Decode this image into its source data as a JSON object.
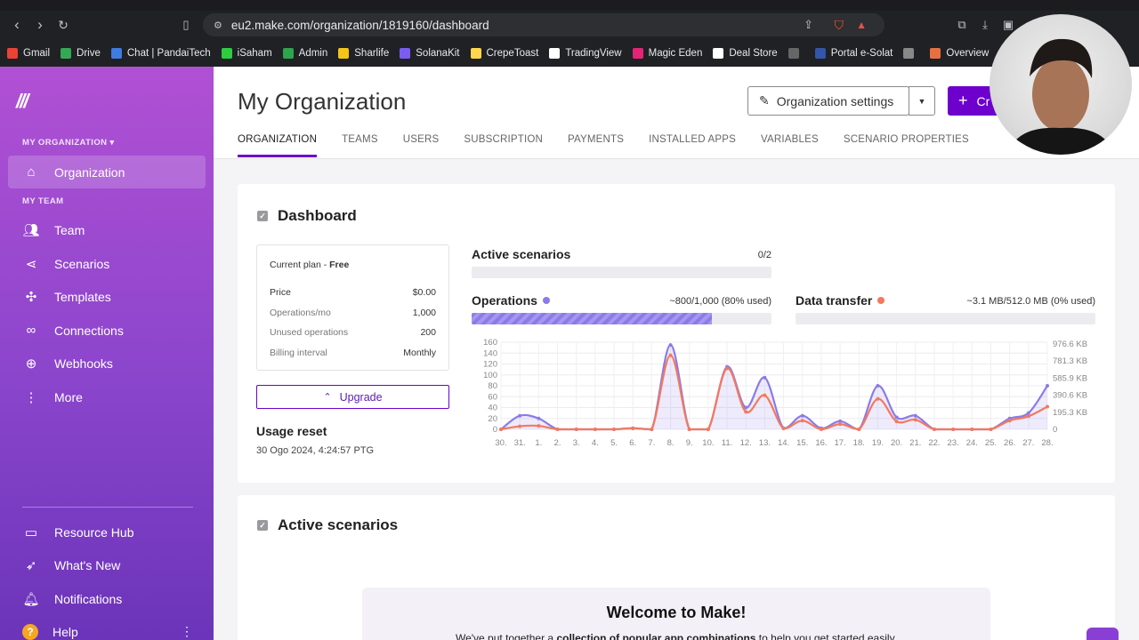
{
  "browser": {
    "url": "eu2.make.com/organization/1819160/dashboard",
    "bookmarks": [
      {
        "label": "Gmail",
        "color": "#ea4335"
      },
      {
        "label": "Drive",
        "color": "#34a853"
      },
      {
        "label": "Chat | PandaiTech",
        "color": "#3f7be0"
      },
      {
        "label": "iSaham",
        "color": "#2ecc40"
      },
      {
        "label": "Admin",
        "color": "#2ea44f"
      },
      {
        "label": "Sharlife",
        "color": "#f5c518"
      },
      {
        "label": "SolanaKit",
        "color": "#7b5cf0"
      },
      {
        "label": "CrepeToast",
        "color": "#ffd84d"
      },
      {
        "label": "TradingView",
        "color": "#ffffff"
      },
      {
        "label": "Magic Eden",
        "color": "#e42575"
      },
      {
        "label": "Deal Store",
        "color": "#ffffff"
      },
      {
        "label": "",
        "color": "#666666"
      },
      {
        "label": "Portal e-Solat",
        "color": "#3355aa"
      },
      {
        "label": "",
        "color": "#888888"
      },
      {
        "label": "Overview",
        "color": "#e87040"
      }
    ]
  },
  "sidebar": {
    "org_label": "MY ORGANIZATION ▾",
    "org_item": "Organization",
    "team_label": "MY TEAM",
    "items": [
      "Team",
      "Scenarios",
      "Templates",
      "Connections",
      "Webhooks",
      "More"
    ],
    "bottom_items": [
      "Resource Hub",
      "What's New",
      "Notifications",
      "Help"
    ]
  },
  "header": {
    "title": "My Organization",
    "settings_label": "Organization settings",
    "create_label": "Cr",
    "tabs": [
      "ORGANIZATION",
      "TEAMS",
      "USERS",
      "SUBSCRIPTION",
      "PAYMENTS",
      "INSTALLED APPS",
      "VARIABLES",
      "SCENARIO PROPERTIES"
    ]
  },
  "dashboard": {
    "title": "Dashboard",
    "plan": {
      "current_plan_label": "Current plan - ",
      "current_plan_value": "Free",
      "rows": [
        {
          "k": "Price",
          "v": "$0.00"
        },
        {
          "k": "Operations/mo",
          "v": "1,000"
        },
        {
          "k": "Unused operations",
          "v": "200"
        },
        {
          "k": "Billing interval",
          "v": "Monthly"
        }
      ]
    },
    "upgrade_label": "Upgrade",
    "usage_reset_title": "Usage reset",
    "usage_reset_value": "30 Ogo 2024, 4:24:57 PTG",
    "active_scenarios": {
      "label": "Active scenarios",
      "value": "0/2",
      "fraction": 0.0
    },
    "operations": {
      "label": "Operations",
      "value": "~800/1,000 (80% used)",
      "fraction": 0.8,
      "color": "#8b7be8"
    },
    "data_transfer": {
      "label": "Data transfer",
      "value": "~3.1 MB/512.0 MB (0% used)",
      "fraction": 0.0,
      "color": "#f27a5e"
    }
  },
  "chart_data": {
    "type": "line",
    "categories": [
      "30.",
      "31.",
      "1.",
      "2.",
      "3.",
      "4.",
      "5.",
      "6.",
      "7.",
      "8.",
      "9.",
      "10.",
      "11.",
      "12.",
      "13.",
      "14.",
      "15.",
      "16.",
      "17.",
      "18.",
      "19.",
      "20.",
      "21.",
      "22.",
      "23.",
      "24.",
      "25.",
      "26.",
      "27.",
      "28."
    ],
    "y_left_ticks": [
      "0",
      "20",
      "40",
      "60",
      "80",
      "100",
      "120",
      "140",
      "160"
    ],
    "y_left_range": [
      0,
      160
    ],
    "y_right_ticks": [
      "0",
      "195.3 KB",
      "390.6 KB",
      "585.9 KB",
      "781.3 KB",
      "976.6 KB"
    ],
    "series": [
      {
        "name": "Operations",
        "axis": "left",
        "color": "#8b7be8",
        "values": [
          0,
          25,
          20,
          0,
          0,
          0,
          0,
          2,
          0,
          155,
          0,
          0,
          115,
          40,
          95,
          2,
          25,
          2,
          15,
          0,
          80,
          22,
          25,
          0,
          0,
          0,
          0,
          20,
          30,
          80
        ]
      },
      {
        "name": "Data transfer",
        "axis": "right",
        "color": "#f27a5e",
        "values": [
          0,
          35,
          40,
          0,
          0,
          0,
          0,
          10,
          0,
          850,
          0,
          0,
          700,
          200,
          390,
          10,
          100,
          0,
          60,
          0,
          350,
          90,
          110,
          0,
          0,
          0,
          0,
          100,
          150,
          260
        ]
      }
    ],
    "grid": true
  },
  "active_section": {
    "title": "Active scenarios",
    "welcome_title": "Welcome to Make!",
    "welcome_pre": "We've put together a ",
    "welcome_bold": "collection of popular app combinations",
    "welcome_post": " to help you get started easily."
  }
}
